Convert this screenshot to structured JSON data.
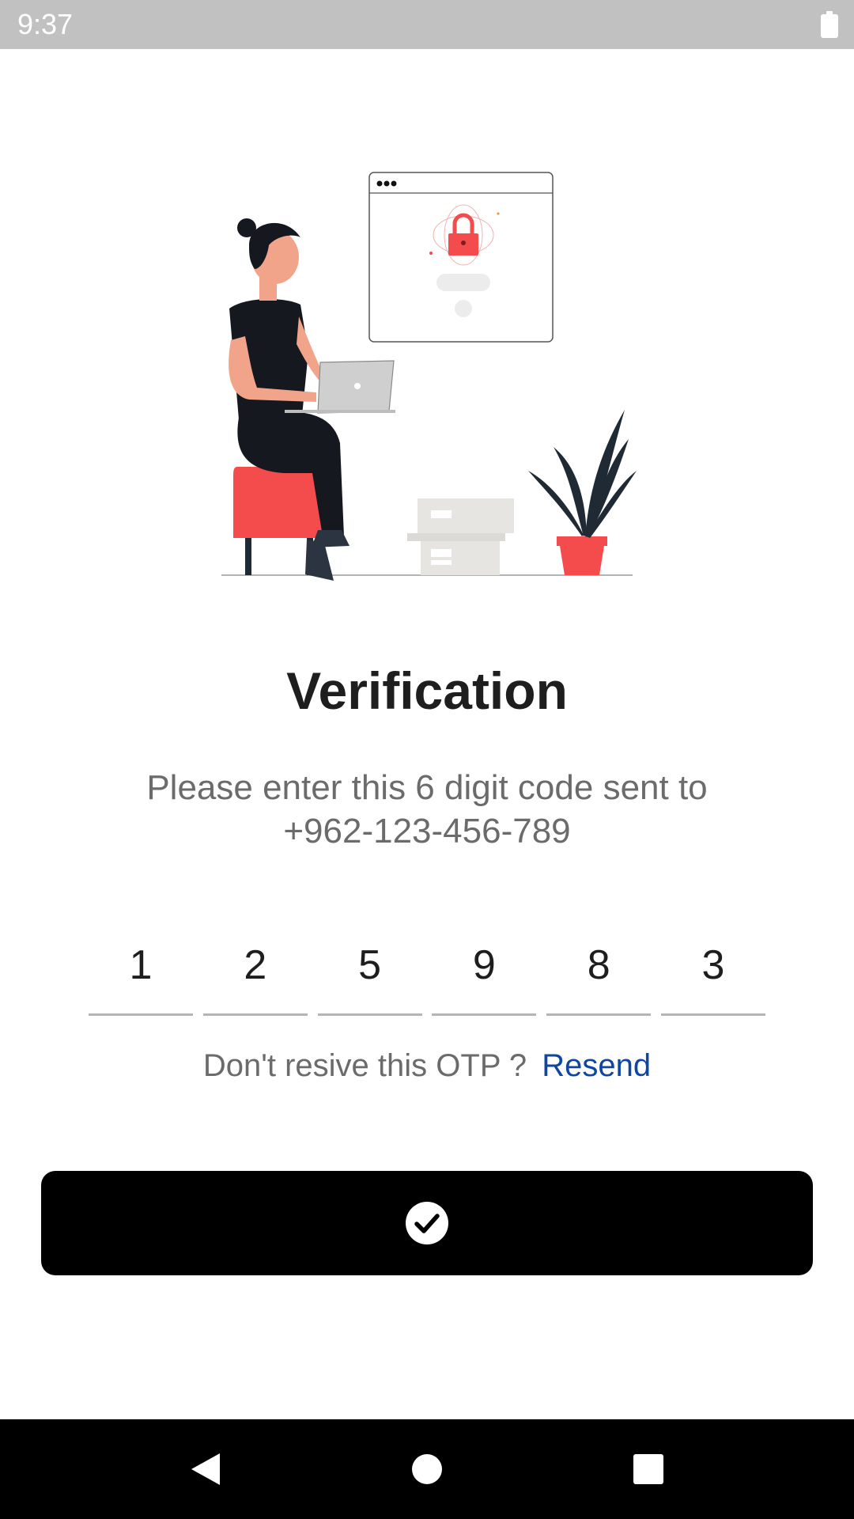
{
  "status_bar": {
    "time": "9:37"
  },
  "screen": {
    "title": "Verification",
    "subtitle_line1": "Please enter this 6 digit code sent to",
    "subtitle_line2": "+962-123-456-789",
    "otp_digits": [
      "1",
      "2",
      "5",
      "9",
      "8",
      "3"
    ],
    "resend_prompt": "Don't resive this OTP ?",
    "resend_label": "Resend"
  },
  "colors": {
    "accent_link": "#0d47a1",
    "button_bg": "#000000",
    "illustration_red": "#f44c4c"
  },
  "icons": {
    "confirm": "check-circle-icon",
    "nav_back": "back-triangle-icon",
    "nav_home": "home-circle-icon",
    "nav_recents": "recents-square-icon"
  }
}
